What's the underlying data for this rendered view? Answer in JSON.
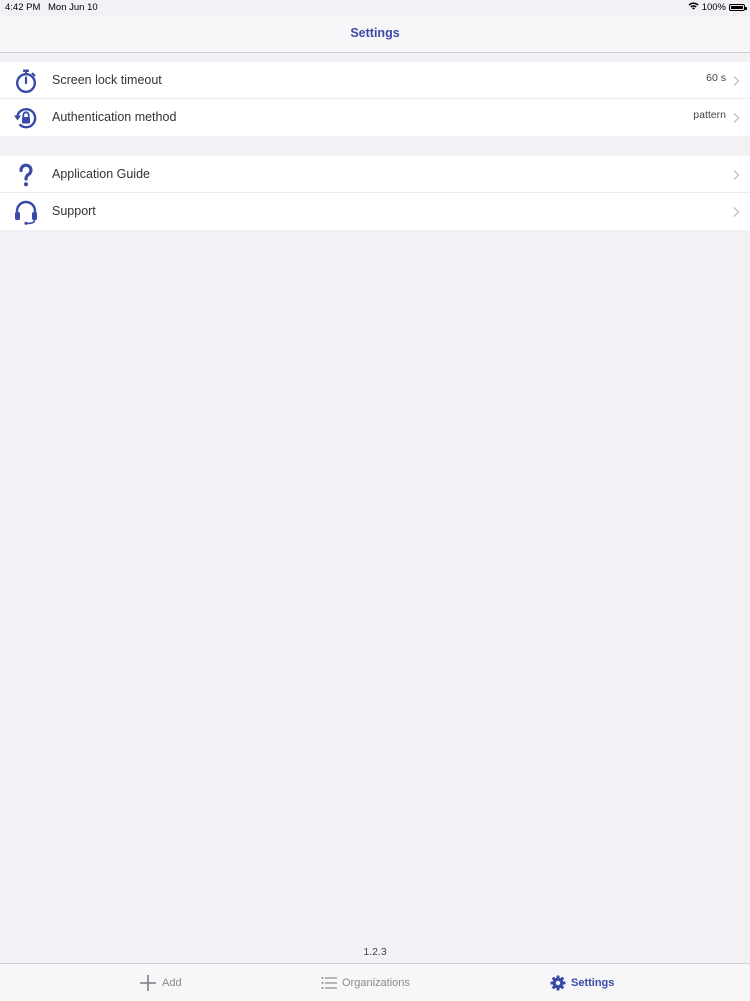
{
  "status_bar": {
    "time": "4:42 PM",
    "date": "Mon Jun 10",
    "battery": "100%"
  },
  "nav": {
    "title": "Settings"
  },
  "groups": [
    {
      "rows": [
        {
          "label": "Screen lock timeout",
          "value": "60 s",
          "icon": "stopwatch-icon"
        },
        {
          "label": "Authentication method",
          "value": "pattern",
          "icon": "lock-refresh-icon"
        }
      ]
    },
    {
      "rows": [
        {
          "label": "Application Guide",
          "value": "",
          "icon": "question-icon"
        },
        {
          "label": "Support",
          "value": "",
          "icon": "headset-icon"
        }
      ]
    }
  ],
  "version": "1.2.3",
  "tabs": [
    {
      "label": "Add",
      "icon": "plus-icon",
      "active": false
    },
    {
      "label": "Organizations",
      "icon": "list-icon",
      "active": false
    },
    {
      "label": "Settings",
      "icon": "gear-icon",
      "active": true
    }
  ],
  "colors": {
    "accent": "#3a4ba7",
    "background": "#f2f2f6",
    "inactive": "#8a8a8e"
  }
}
